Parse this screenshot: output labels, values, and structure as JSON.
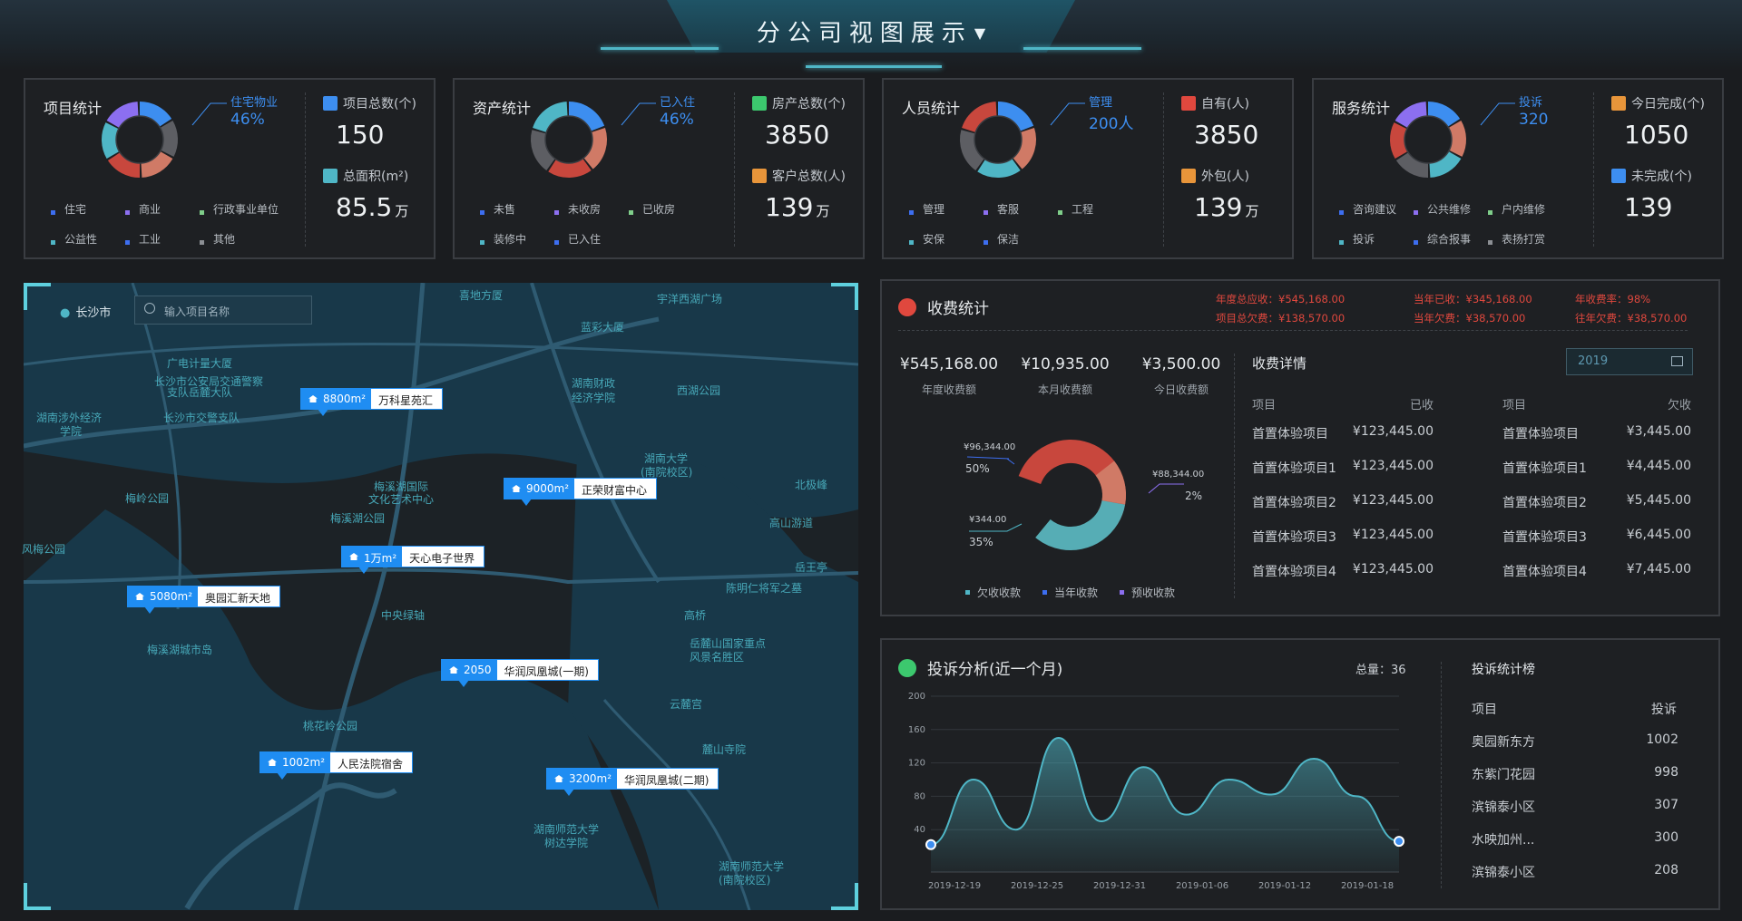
{
  "header": {
    "title": "分公司视图展示"
  },
  "stats": [
    {
      "title": "项目统计",
      "donut_label": "住宅物业",
      "donut_value": "46%",
      "legend": [
        "住宅",
        "商业",
        "行政事业单位",
        "公益性",
        "工业",
        "其他"
      ],
      "kpis": [
        {
          "label": "项目总数(个)",
          "value": "150",
          "unit": ""
        },
        {
          "label": "总面积(m²)",
          "value": "85.5",
          "unit": "万"
        }
      ]
    },
    {
      "title": "资产统计",
      "donut_label": "已入住",
      "donut_value": "46%",
      "legend": [
        "未售",
        "未收房",
        "已收房",
        "装修中",
        "已入住"
      ],
      "kpis": [
        {
          "label": "房产总数(个)",
          "value": "3850",
          "unit": ""
        },
        {
          "label": "客户总数(人)",
          "value": "139",
          "unit": "万"
        }
      ]
    },
    {
      "title": "人员统计",
      "donut_label": "管理",
      "donut_value": "200人",
      "legend": [
        "管理",
        "客服",
        "工程",
        "安保",
        "保洁"
      ],
      "kpis": [
        {
          "label": "自有(人)",
          "value": "3850",
          "unit": ""
        },
        {
          "label": "外包(人)",
          "value": "139",
          "unit": "万"
        }
      ]
    },
    {
      "title": "服务统计",
      "donut_label": "投诉",
      "donut_value": "320",
      "legend": [
        "咨询建议",
        "公共维修",
        "户内维修",
        "投诉",
        "综合报事",
        "表扬打赏"
      ],
      "kpis": [
        {
          "label": "今日完成(个)",
          "value": "1050",
          "unit": ""
        },
        {
          "label": "未完成(个)",
          "value": "139",
          "unit": ""
        }
      ]
    }
  ],
  "map": {
    "city": "长沙市",
    "search_placeholder": "输入项目名称",
    "labels": [
      "喜地方厦",
      "宇洋西湖广场",
      "蓝彩大厦",
      "广电计量大厦",
      "长沙市公安局交通警察",
      "支队岳麓大队",
      "长沙市交警支队",
      "湖南涉外经济",
      "学院",
      "湖南财政",
      "经济学院",
      "西湖公园",
      "湖南大学",
      "(南院校区)",
      "北极峰",
      "梅溪湖国际",
      "文化艺术中心",
      "梅溪湖公园",
      "梅岭公园",
      "高山游道",
      "岳王亭",
      "陈明仁将军之墓",
      "风梅公园",
      "中央绿轴",
      "梅溪湖城市岛",
      "高桥",
      "岳麓山国家重点",
      "风景名胜区",
      "云麓宫",
      "桃花岭公园",
      "麓山寺院",
      "湖南师范大学",
      "树达学院",
      "湖南师范大学",
      "(南院校区)"
    ],
    "pins": [
      {
        "area": "8800m²",
        "name": "万科星苑汇"
      },
      {
        "area": "9000m²",
        "name": "正荣财富中心"
      },
      {
        "area": "1万m²",
        "name": "天心电子世界"
      },
      {
        "area": "5080m²",
        "name": "奥园汇新天地"
      },
      {
        "area": "2050",
        "name": "华润凤凰城(一期)"
      },
      {
        "area": "1002m²",
        "name": "人民法院宿舍"
      },
      {
        "area": "3200m²",
        "name": "华润凤凰城(二期)"
      }
    ]
  },
  "fee": {
    "title": "收费统计",
    "summary": [
      "年度总应收：¥545,168.00",
      "当年已收：¥345,168.00",
      "年收费率：98%",
      "项目总欠费：¥138,570.00",
      "当年欠费：¥38,570.00",
      "往年欠费：¥38,570.00"
    ],
    "totals": [
      {
        "value": "¥545,168.00",
        "label": "年度收费额"
      },
      {
        "value": "¥10,935.00",
        "label": "本月收费额"
      },
      {
        "value": "¥3,500.00",
        "label": "今日收费额"
      }
    ],
    "donut": {
      "labels": [
        {
          "amount": "¥96,344.00",
          "pct": "50%"
        },
        {
          "amount": "¥88,344.00",
          "pct": "2%"
        },
        {
          "amount": "¥344.00",
          "pct": "35%"
        }
      ],
      "legend": [
        "欠收收款",
        "当年收款",
        "预收收款"
      ]
    },
    "detail_title": "收费详情",
    "year": "2019",
    "table_headers": [
      "项目",
      "已收",
      "项目",
      "欠收"
    ],
    "rows": [
      [
        "首置体验项目",
        "¥123,445.00",
        "首置体验项目",
        "¥3,445.00"
      ],
      [
        "首置体验项目1",
        "¥123,445.00",
        "首置体验项目1",
        "¥4,445.00"
      ],
      [
        "首置体验项目2",
        "¥123,445.00",
        "首置体验项目2",
        "¥5,445.00"
      ],
      [
        "首置体验项目3",
        "¥123,445.00",
        "首置体验项目3",
        "¥6,445.00"
      ],
      [
        "首置体验项目4",
        "¥123,445.00",
        "首置体验项目4",
        "¥7,445.00"
      ]
    ]
  },
  "complaints": {
    "title": "投诉分析(近一个月)",
    "total_label": "总量：",
    "total_value": "36",
    "rank_title": "投诉统计榜",
    "rank_headers": [
      "项目",
      "投诉"
    ],
    "rank": [
      {
        "name": "奥园新东方",
        "count": "1002"
      },
      {
        "name": "东紫门花园",
        "count": "998"
      },
      {
        "name": "滨锦泰小区",
        "count": "307"
      },
      {
        "name": "水映加州...",
        "count": "300"
      },
      {
        "name": "滨锦泰小区",
        "count": "208"
      }
    ]
  },
  "chart_data": {
    "type": "area",
    "x": [
      "2019-12-19",
      "2019-12-22",
      "2019-12-25",
      "2019-12-28",
      "2019-12-31",
      "2020-01-03",
      "2020-01-06",
      "2020-01-09",
      "2020-01-12",
      "2020-01-15",
      "2020-01-18",
      "2020-01-20"
    ],
    "x_tick_labels": [
      "2019-12-19",
      "2019-12-25",
      "2019-12-31",
      "2019-01-06",
      "2019-01-12",
      "2019-01-18"
    ],
    "values": [
      22,
      100,
      40,
      150,
      50,
      115,
      58,
      100,
      82,
      125,
      80,
      26
    ],
    "ylim": [
      0,
      200
    ],
    "y_ticks": [
      40,
      80,
      120,
      160,
      200
    ],
    "title": "",
    "xlabel": "",
    "ylabel": "",
    "color": "#4fb6c6"
  }
}
